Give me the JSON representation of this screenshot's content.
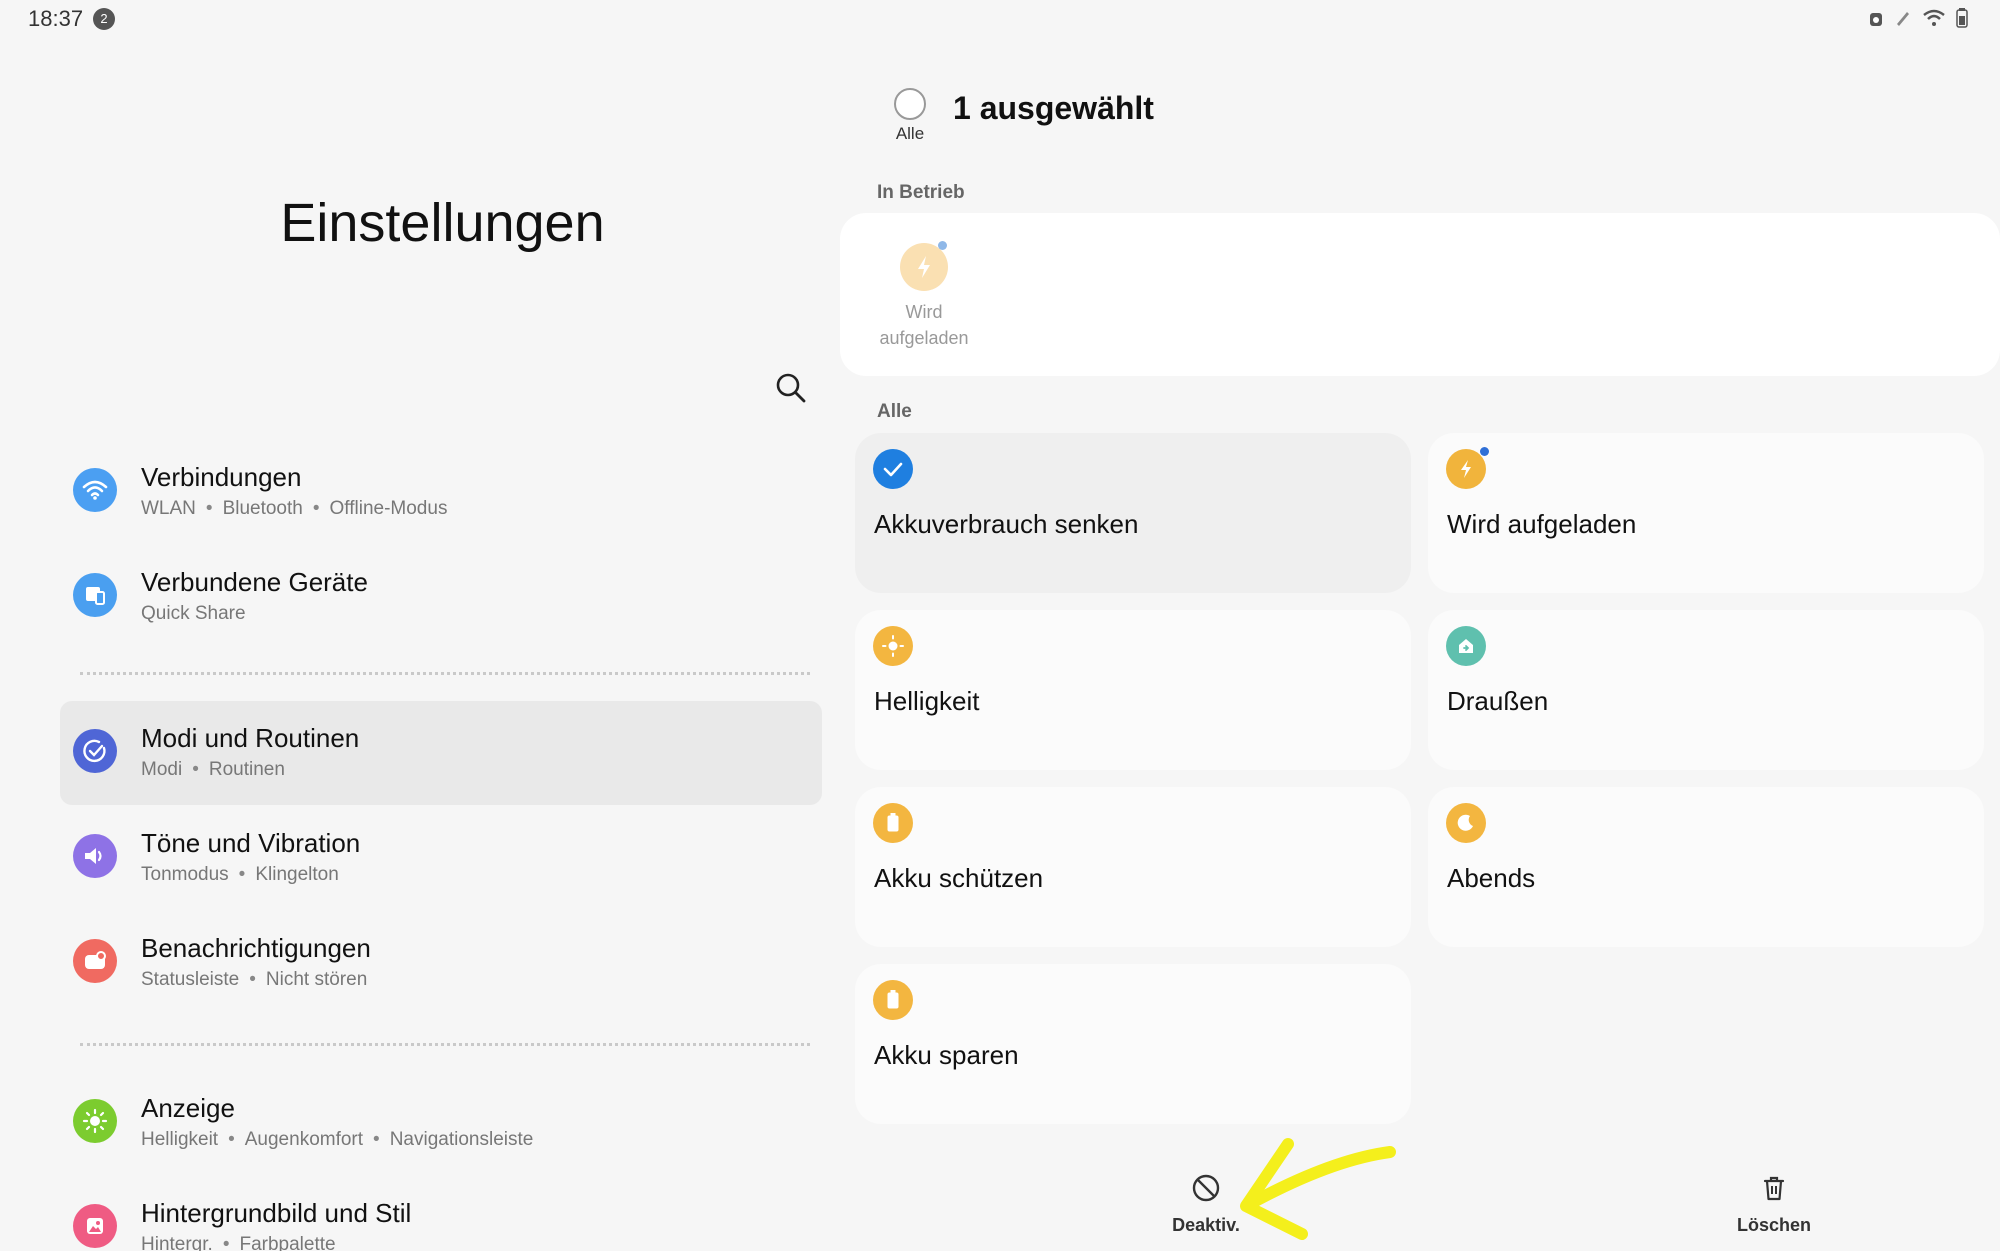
{
  "status_bar": {
    "time": "18:37",
    "notification_count": "2"
  },
  "settings": {
    "title": "Einstellungen",
    "items": [
      {
        "title": "Verbindungen",
        "subs": [
          "WLAN",
          "Bluetooth",
          "Offline-Modus"
        ],
        "icon": "wifi-icon",
        "color": "#4b9ff2"
      },
      {
        "title": "Verbundene Geräte",
        "subs": [
          "Quick Share"
        ],
        "icon": "devices-icon",
        "color": "#4a9ff0"
      },
      {
        "title": "Modi und Routinen",
        "subs": [
          "Modi",
          "Routinen"
        ],
        "icon": "routine-check-icon",
        "color": "#4f66d6",
        "selected": true
      },
      {
        "title": "Töne und Vibration",
        "subs": [
          "Tonmodus",
          "Klingelton"
        ],
        "icon": "speaker-icon",
        "color": "#8e72e6"
      },
      {
        "title": "Benachrichtigungen",
        "subs": [
          "Statusleiste",
          "Nicht stören"
        ],
        "icon": "notification-icon",
        "color": "#f06a61"
      },
      {
        "title": "Anzeige",
        "subs": [
          "Helligkeit",
          "Augenkomfort",
          "Navigationsleiste"
        ],
        "icon": "sun-icon",
        "color": "#7ccc2f"
      },
      {
        "title": "Hintergrundbild und Stil",
        "subs": [
          "Hintergr.",
          "Farbpalette"
        ],
        "icon": "wallpaper-icon",
        "color": "#ef5b83"
      }
    ]
  },
  "modes": {
    "select_all_label": "Alle",
    "selected_title": "1 ausgewählt",
    "active_section": "In Betrieb",
    "active_item": {
      "line1": "Wird",
      "line2": "aufgeladen"
    },
    "all_section": "Alle",
    "cards": [
      {
        "label": "Akkuverbrauch senken",
        "icon": "check-icon",
        "color": "#1f7fe0",
        "checked": true
      },
      {
        "label": "Wird aufgeladen",
        "icon": "charging-bolt-icon",
        "color": "#f1b43c",
        "indicator": true
      },
      {
        "label": "Helligkeit",
        "icon": "sun-icon",
        "color": "#f3b640"
      },
      {
        "label": "Draußen",
        "icon": "outdoor-home-icon",
        "color": "#5fc0ae"
      },
      {
        "label": "Akku schützen",
        "icon": "battery-icon",
        "color": "#f3b640"
      },
      {
        "label": "Abends",
        "icon": "moon-icon",
        "color": "#f3b640"
      },
      {
        "label": "Akku sparen",
        "icon": "battery-icon",
        "color": "#f3b640"
      }
    ]
  },
  "actions": {
    "deactivate_label": "Deaktiv.",
    "delete_label": "Löschen"
  },
  "annotation": {
    "color": "#f4ef1c"
  }
}
